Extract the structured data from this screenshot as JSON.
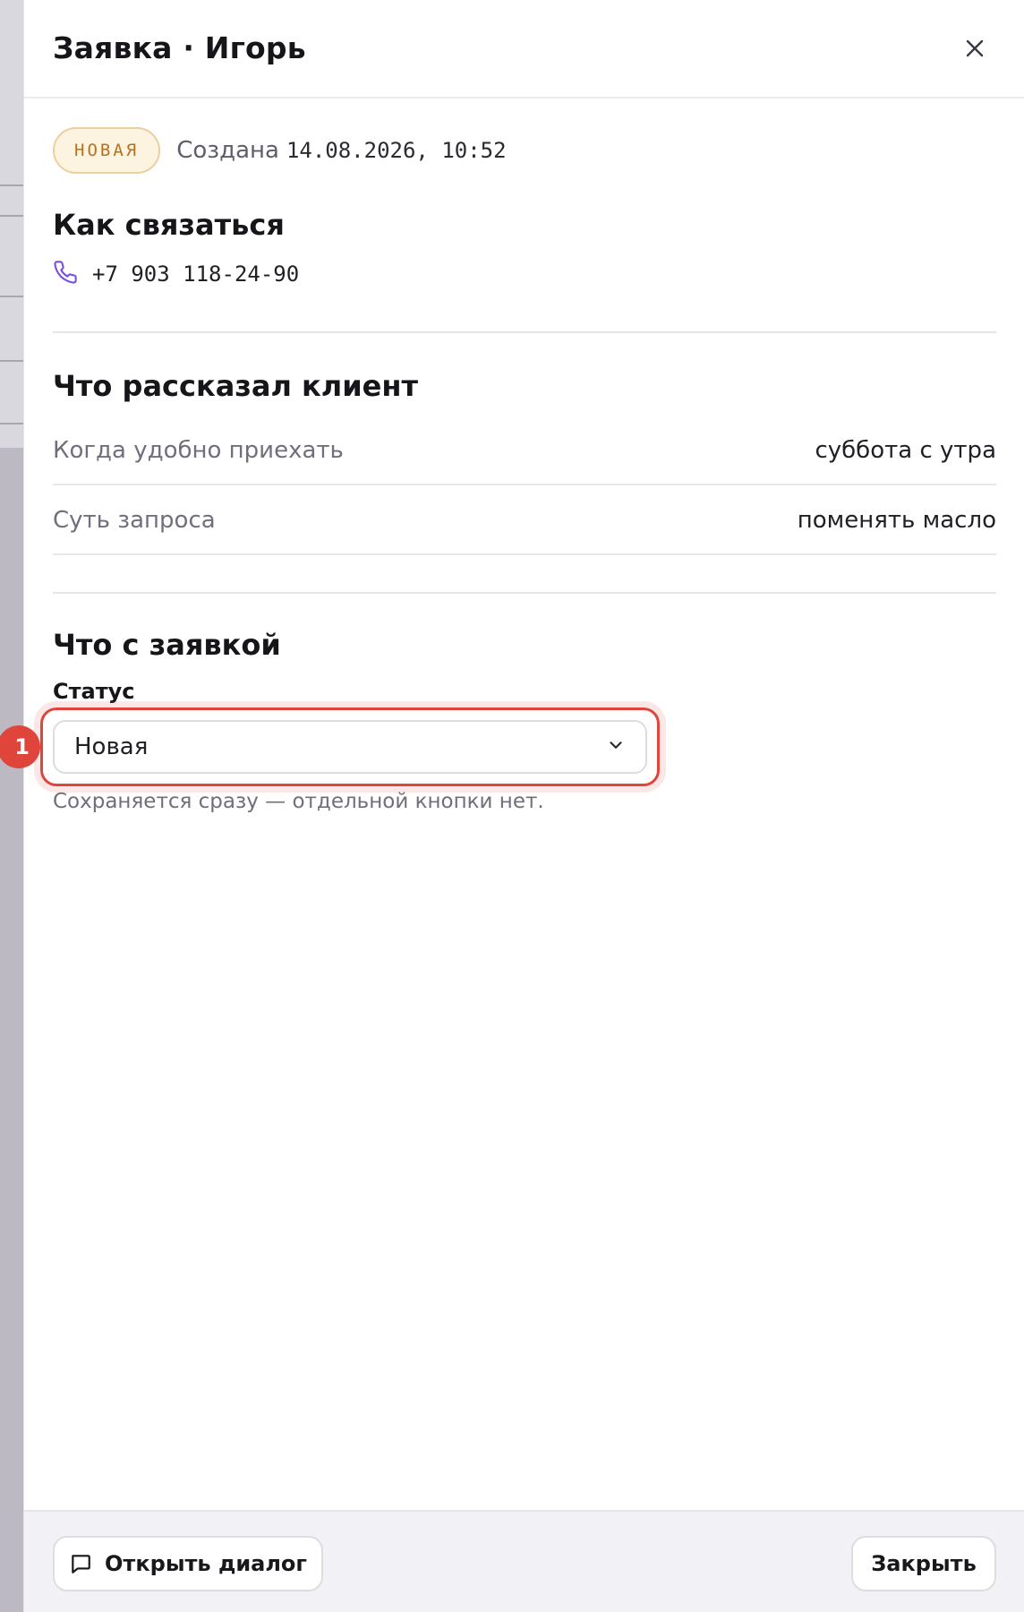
{
  "drawer": {
    "title": "Заявка · Игорь",
    "close_icon": "close-icon"
  },
  "meta": {
    "badge": "НОВАЯ",
    "created_label": "Создана",
    "created_value": "14.08.2026, 10:52"
  },
  "contact": {
    "title": "Как связаться",
    "phone_icon": "phone-icon",
    "phone": "+7 903 118-24-90"
  },
  "client_info": {
    "title": "Что рассказал клиент",
    "rows": [
      {
        "label": "Когда удобно приехать",
        "value": "суббота с утра"
      },
      {
        "label": "Суть запроса",
        "value": "поменять масло"
      }
    ]
  },
  "request": {
    "title": "Что с заявкой",
    "status_label": "Статус",
    "status_value": "Новая",
    "hint": "Сохраняется сразу — отдельной кнопки нет.",
    "step_marker": "1"
  },
  "footer": {
    "open_dialog_label": "Открыть диалог",
    "close_label": "Закрыть"
  },
  "colors": {
    "accent_highlight": "#e0453c",
    "badge_text": "#b5741a",
    "badge_bg": "#fdf3e1",
    "phone_icon": "#7b4de0"
  }
}
